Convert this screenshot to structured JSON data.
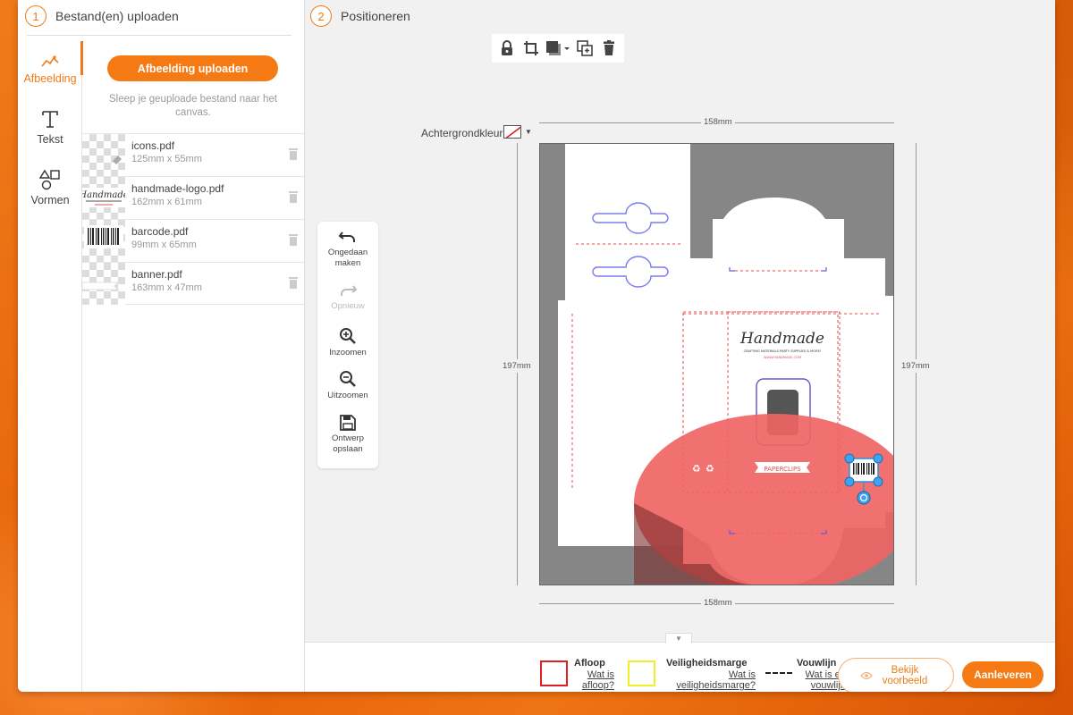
{
  "left": {
    "step_number": "1",
    "step_title": "Bestand(en) uploaden",
    "tabs": [
      {
        "label": "Afbeelding",
        "icon": "image-line-icon",
        "active": true
      },
      {
        "label": "Tekst",
        "icon": "text-t-icon",
        "active": false
      },
      {
        "label": "Vormen",
        "icon": "shapes-icon",
        "active": false
      }
    ],
    "upload_button": "Afbeelding uploaden",
    "drop_hint": "Sleep je geuploade bestand naar het canvas.",
    "files": [
      {
        "name": "icons.pdf",
        "size": "125mm x 55mm"
      },
      {
        "name": "handmade-logo.pdf",
        "size": "162mm x 61mm"
      },
      {
        "name": "barcode.pdf",
        "size": "99mm x 65mm"
      },
      {
        "name": "banner.pdf",
        "size": "163mm x 47mm"
      }
    ]
  },
  "right": {
    "step_number": "2",
    "step_title": "Positioneren",
    "toolbar": [
      "lock-icon",
      "crop-icon",
      "layer-order-icon",
      "duplicate-icon",
      "delete-icon"
    ],
    "background_label": "Achtergrondkleur",
    "dimensions": {
      "width": "158mm",
      "height": "197mm"
    },
    "canvas": {
      "logo_title": "Handmade",
      "logo_tagline": "CRAFTING MATERIALS PARTY SUPPLIES & MORE!",
      "logo_url": "WWW.HANDMADE.COM",
      "banner_text": "PAPERCLIPS",
      "icons_text": "♻",
      "overlay_color": "#f06464"
    },
    "side_tools": [
      {
        "label": "Ongedaan maken",
        "icon": "undo-icon",
        "enabled": true
      },
      {
        "label": "Opnieuw",
        "icon": "redo-icon",
        "enabled": false
      },
      {
        "label": "Inzoomen",
        "icon": "zoom-in-icon",
        "enabled": true
      },
      {
        "label": "Uitzoomen",
        "icon": "zoom-out-icon",
        "enabled": true
      },
      {
        "label": "Ontwerp opslaan",
        "icon": "save-icon",
        "enabled": true
      }
    ]
  },
  "bottom": {
    "legend": [
      {
        "title": "Afloop",
        "link": "Wat is afloop?",
        "color": "#e02020"
      },
      {
        "title": "Veiligheidsmarge",
        "link": "Wat is veiligheidsmarge?",
        "color": "#f4ee2a"
      },
      {
        "title": "Vouwlijn",
        "link": "Wat is een vouwlijn?",
        "color": "#222222"
      }
    ],
    "preview_button": "Bekijk voorbeeld",
    "deliver_button": "Aanleveren"
  }
}
